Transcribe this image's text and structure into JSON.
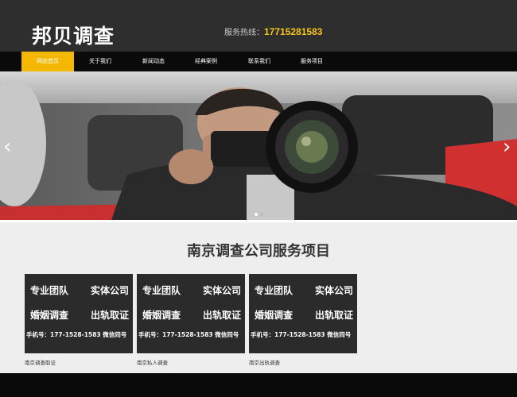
{
  "header": {
    "logo": "邦贝调查",
    "hotline_label": "服务热线：",
    "hotline_number": "17715281583"
  },
  "nav": {
    "items": [
      {
        "label": "网站首页",
        "active": true
      },
      {
        "label": "关于我们"
      },
      {
        "label": "新闻动态"
      },
      {
        "label": "经典案例"
      },
      {
        "label": "联系我们"
      },
      {
        "label": "服务项目"
      }
    ]
  },
  "banner": {
    "prev_icon": "chevron-left-icon",
    "next_icon": "chevron-right-icon",
    "slides_count": 2,
    "active_slide": 1
  },
  "services": {
    "title": "南京调查公司服务项目",
    "cards": [
      {
        "img": {
          "l1": "专业团队",
          "r1": "实体公司",
          "l2": "婚姻调查",
          "r2": "出轨取证",
          "l3": "手机号：177-1528-1583 微信同号"
        },
        "caption": "南京调查取证"
      },
      {
        "img": {
          "l1": "专业团队",
          "r1": "实体公司",
          "l2": "婚姻调查",
          "r2": "出轨取证",
          "l3": "手机号：177-1528-1583 微信同号"
        },
        "caption": "南京私人调查"
      },
      {
        "img": {
          "l1": "专业团队",
          "r1": "实体公司",
          "l2": "婚姻调查",
          "r2": "出轨取证",
          "l3": "手机号：177-1528-1583 微信同号"
        },
        "caption": "南京出轨调查"
      }
    ]
  },
  "colors": {
    "header_bg": "#2e2e2e",
    "nav_bg": "#0a0a0a",
    "accent": "#f5b800",
    "hotline": "#f5c518"
  }
}
